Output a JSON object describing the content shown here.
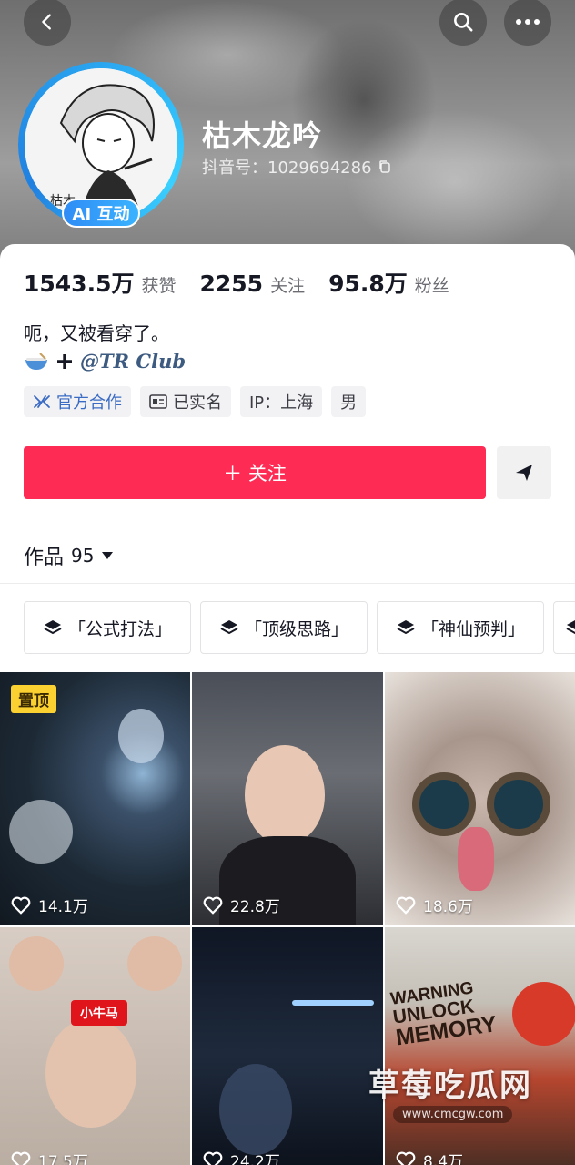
{
  "header": {
    "back_icon": "chevron-left-icon",
    "search_icon": "search-icon",
    "more_icon": "more-horizontal-icon"
  },
  "profile": {
    "nickname": "枯木龙吟",
    "douyin_id": "抖音号：1029694286",
    "ai_badge": "AI 互动"
  },
  "stats": [
    {
      "value": "1543.5万",
      "label": "获赞"
    },
    {
      "value": "2255",
      "label": "关注"
    },
    {
      "value": "95.8万",
      "label": "粉丝"
    }
  ],
  "bio": {
    "line1": "呃，又被看穿了。",
    "mention": "@TR Club"
  },
  "tags": [
    {
      "label": "官方合作",
      "icon": "handshake-icon"
    },
    {
      "label": "已实名",
      "icon": "id-card-icon"
    },
    {
      "label": "IP：上海"
    },
    {
      "label": "男"
    }
  ],
  "actions": {
    "follow_label": "＋ 关注",
    "share_icon": "send-icon"
  },
  "works": {
    "label": "作品",
    "count": "95"
  },
  "collections": [
    {
      "label": "「公式打法」"
    },
    {
      "label": "「顶级思路」"
    },
    {
      "label": "「神仙预判」"
    }
  ],
  "videos": [
    {
      "likes": "14.1万",
      "pinned": "置顶"
    },
    {
      "likes": "22.8万"
    },
    {
      "likes": "18.6万"
    },
    {
      "likes": "17.5万",
      "sticker": "小牛马"
    },
    {
      "likes": "24.2万"
    },
    {
      "likes": "8.4万",
      "text_lines": [
        "WARNING",
        "UNLOCK",
        "MEMORY"
      ]
    }
  ],
  "watermark": {
    "title": "草莓吃瓜网",
    "url": "www.cmcgw.com"
  },
  "colors": {
    "follow_button": "#fe2c55",
    "pin_badge": "#fbd132",
    "avatar_ring": "#2aa6f0"
  }
}
